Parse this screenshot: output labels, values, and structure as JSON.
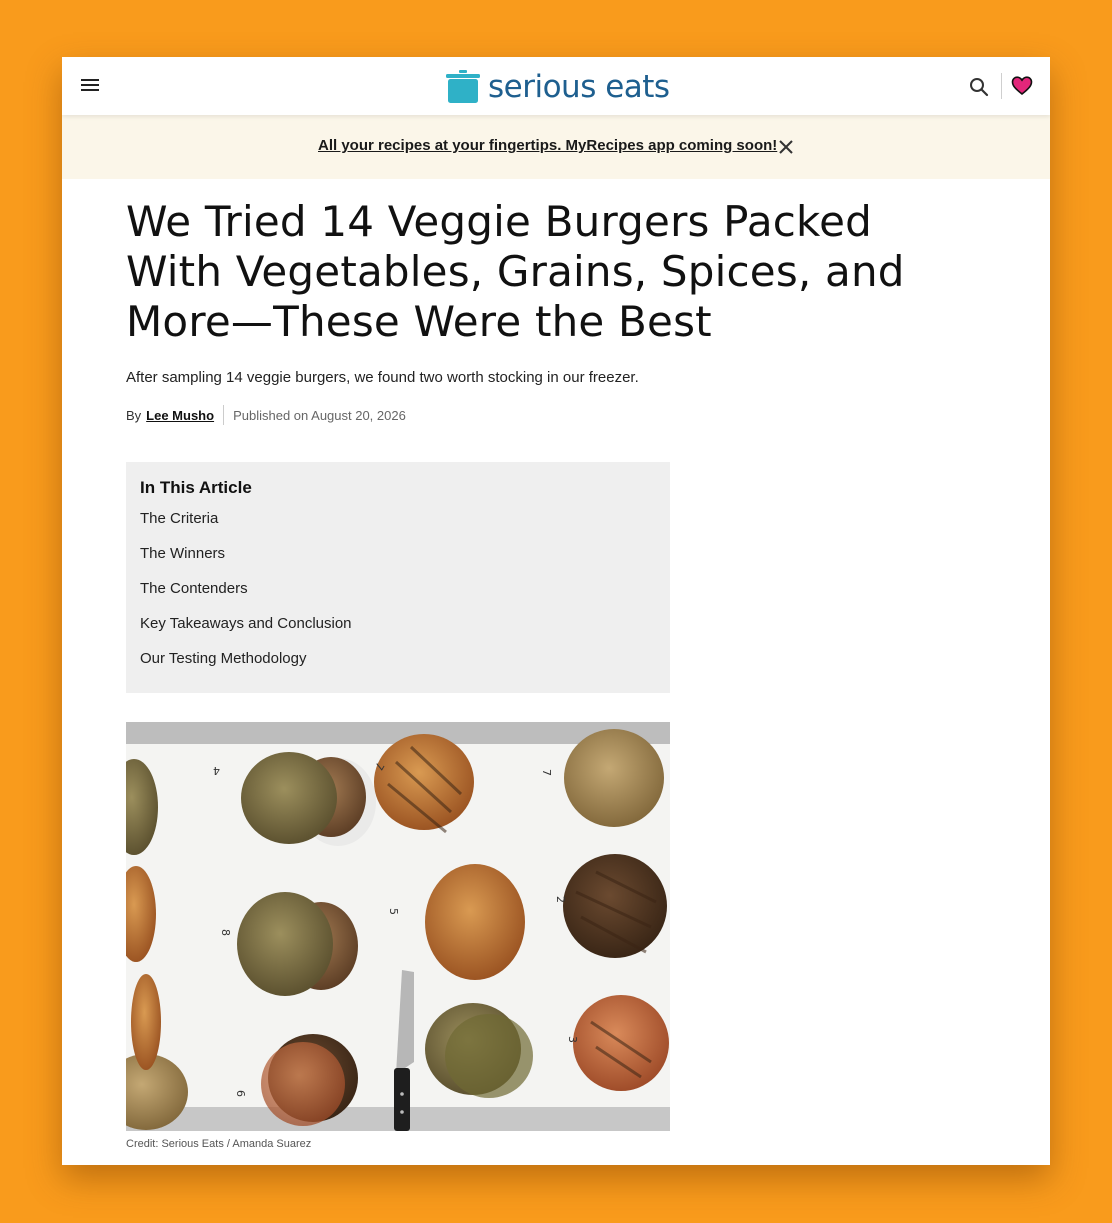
{
  "header": {
    "logo_text": "serious eats",
    "icons": [
      "hamburger-menu-icon",
      "pot-logo-icon",
      "search-icon",
      "heart-icon"
    ],
    "colors": {
      "logo_text": "#1e5f8f",
      "logo_pot": "#2fb1c7",
      "heart": "#e2267a"
    }
  },
  "banner": {
    "text": "All your recipes at your fingertips. MyRecipes app coming soon!",
    "close_icon": "close-icon"
  },
  "article": {
    "title": "We Tried 14 Veggie Burgers Packed With Vegetables, Grains, Spices, and More—These Were the Best",
    "subtitle": "After sampling 14 veggie burgers, we found two worth stocking in our freezer.",
    "by_label": "By",
    "author": "Lee Musho",
    "published": "Published on August 20, 2026",
    "toc": {
      "heading": "In This Article",
      "items": [
        "The Criteria",
        "The Winners",
        "The Contenders",
        "Key Takeaways and Conclusion",
        "Our Testing Methodology"
      ]
    },
    "image_credit": "Credit: Serious Eats / Amanda Suarez",
    "image_labels": [
      "4",
      "7",
      "7",
      "5",
      "8",
      "2",
      "3",
      "6"
    ]
  },
  "theme": {
    "page_background": "#f99b1c",
    "banner_background": "#fbf6e9",
    "toc_background": "#efefef"
  }
}
